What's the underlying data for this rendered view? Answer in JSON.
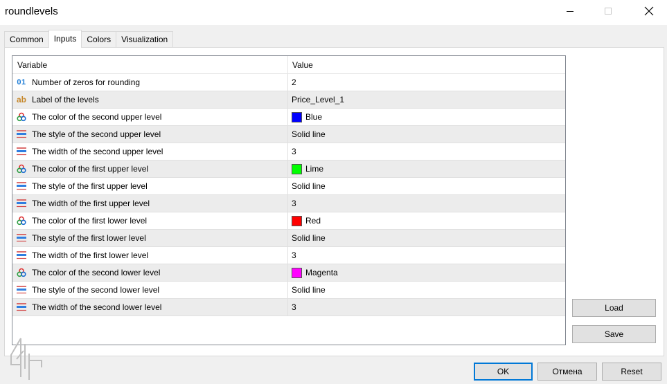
{
  "window": {
    "title": "roundlevels"
  },
  "tabs": [
    {
      "label": "Common",
      "active": false
    },
    {
      "label": "Inputs",
      "active": true
    },
    {
      "label": "Colors",
      "active": false
    },
    {
      "label": "Visualization",
      "active": false
    }
  ],
  "grid": {
    "headers": {
      "variable": "Variable",
      "value": "Value"
    },
    "rows": [
      {
        "icon": "numeric-icon",
        "icon_text": "01",
        "variable": "Number of zeros for rounding",
        "value": "2"
      },
      {
        "icon": "text-icon",
        "icon_text": "ab",
        "variable": "Label of the levels",
        "value": "Price_Level_1"
      },
      {
        "icon": "color-icon",
        "variable": "The color of the second upper level",
        "value": "Blue",
        "swatch": "#0000ff"
      },
      {
        "icon": "style-icon",
        "variable": "The style of the second upper level",
        "value": "Solid line"
      },
      {
        "icon": "style-icon",
        "variable": "The width of the second upper level",
        "value": "3"
      },
      {
        "icon": "color-icon",
        "variable": "The color of the first upper level",
        "value": "Lime",
        "swatch": "#00ff00"
      },
      {
        "icon": "style-icon",
        "variable": "The style of the first upper level",
        "value": "Solid line"
      },
      {
        "icon": "style-icon",
        "variable": "The width of the first upper level",
        "value": "3"
      },
      {
        "icon": "color-icon",
        "variable": "The color of the first lower level",
        "value": "Red",
        "swatch": "#ff0000"
      },
      {
        "icon": "style-icon",
        "variable": "The style of the first lower level",
        "value": "Solid line"
      },
      {
        "icon": "style-icon",
        "variable": "The width of the first lower level",
        "value": "3"
      },
      {
        "icon": "color-icon",
        "variable": "The color of the second lower level",
        "value": "Magenta",
        "swatch": "#ff00ff"
      },
      {
        "icon": "style-icon",
        "variable": "The style of the second lower level",
        "value": "Solid line"
      },
      {
        "icon": "style-icon",
        "variable": "The width of the second lower level",
        "value": "3"
      }
    ]
  },
  "buttons": {
    "load": "Load",
    "save": "Save",
    "ok": "OK",
    "cancel": "Отмена",
    "reset": "Reset"
  },
  "colors": {
    "accent": "#0078d7",
    "row_alt": "#ececec"
  }
}
